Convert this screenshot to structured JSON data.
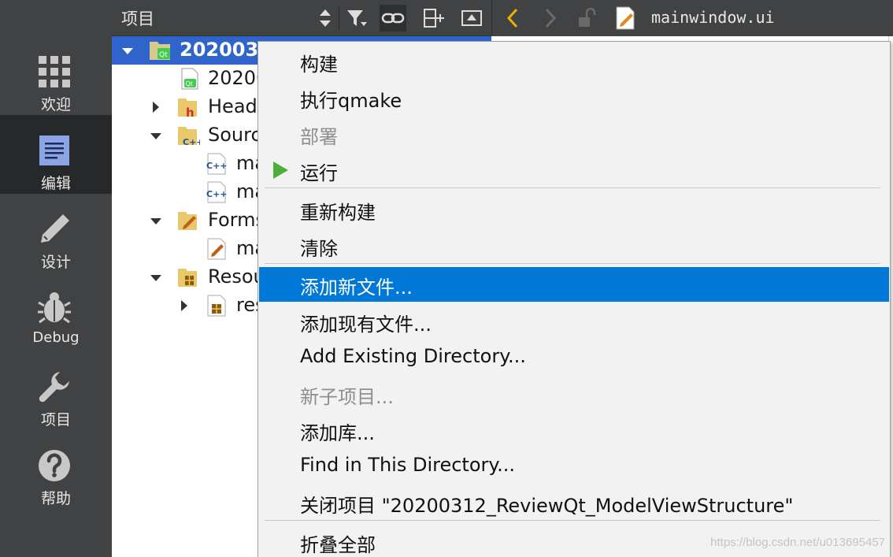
{
  "modes": [
    {
      "label": "欢迎",
      "icon": "grid-icon"
    },
    {
      "label": "编辑",
      "icon": "document-icon",
      "active": true
    },
    {
      "label": "设计",
      "icon": "pencil-icon"
    },
    {
      "label": "Debug",
      "icon": "bug-icon"
    },
    {
      "label": "项目",
      "icon": "wrench-icon"
    },
    {
      "label": "帮助",
      "icon": "help-icon"
    }
  ],
  "tree_header": {
    "title": "项目"
  },
  "editor": {
    "filename": "mainwindow.ui"
  },
  "tree": [
    {
      "label": "2020031",
      "icon": "qt-project-icon"
    },
    {
      "label": "20200",
      "icon": "qt-file-icon"
    },
    {
      "label": "Head",
      "icon": "headers-folder-icon"
    },
    {
      "label": "Sourc",
      "icon": "sources-folder-icon"
    },
    {
      "label": "ma",
      "icon": "cpp-file-icon"
    },
    {
      "label": "ma",
      "icon": "cpp-file-icon"
    },
    {
      "label": "Forms",
      "icon": "forms-folder-icon"
    },
    {
      "label": "ma",
      "icon": "ui-file-icon"
    },
    {
      "label": "Resou",
      "icon": "resources-folder-icon"
    },
    {
      "label": "res",
      "icon": "resource-file-icon"
    }
  ],
  "menu": {
    "build": "构建",
    "run_qmake": "执行qmake",
    "deploy": "部署",
    "run": "运行",
    "rebuild": "重新构建",
    "clean": "清除",
    "add_new_file": "添加新文件...",
    "add_existing_files": "添加现有文件...",
    "add_existing_directory": "Add Existing Directory...",
    "new_subproject": "新子项目...",
    "add_library": "添加库...",
    "find_in_directory": "Find in This Directory...",
    "close_project": "关闭项目 \"20200312_ReviewQt_ModelViewStructure\"",
    "collapse_all": "折叠全部"
  },
  "watermark": "https://blog.csdn.net/u013695457",
  "colors": {
    "sidebar": "#404244",
    "sidebar_active": "#262829",
    "selection": "#2f65ca",
    "menu_highlight": "#0078d7",
    "run_green": "#4caf3c"
  }
}
